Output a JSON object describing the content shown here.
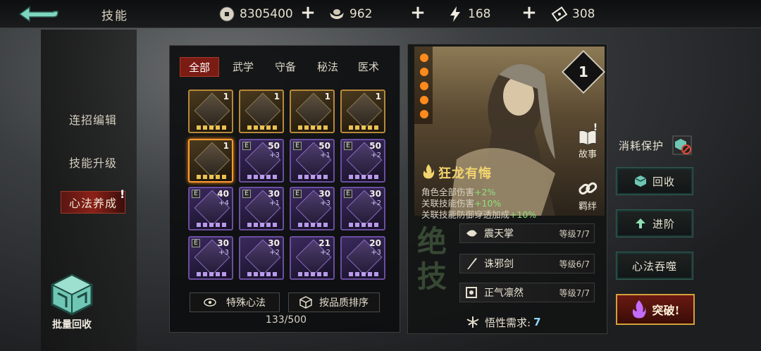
{
  "header": {
    "title": "技能",
    "resources": [
      {
        "name": "coin",
        "value": "8305400",
        "icon": "coin-icon"
      },
      {
        "name": "ingot",
        "value": "962",
        "icon": "ingot-icon"
      },
      {
        "name": "stamina",
        "value": "168",
        "icon": "lightning-icon"
      },
      {
        "name": "ticket",
        "value": "308",
        "icon": "ticket-icon"
      }
    ]
  },
  "sidebar": {
    "items": [
      {
        "label": "连招编辑"
      },
      {
        "label": "技能升级"
      },
      {
        "label": "心法养成"
      }
    ],
    "alert": "!",
    "batch_label": "批量回收"
  },
  "grid": {
    "tabs": [
      {
        "label": "全部"
      },
      {
        "label": "武学"
      },
      {
        "label": "守备"
      },
      {
        "label": "秘法"
      },
      {
        "label": "医术"
      }
    ],
    "cards": [
      {
        "lvl": "1",
        "sub": "",
        "eq": "",
        "style": "gold"
      },
      {
        "lvl": "1",
        "sub": "",
        "eq": "",
        "style": "gold"
      },
      {
        "lvl": "1",
        "sub": "",
        "eq": "",
        "style": "gold"
      },
      {
        "lvl": "1",
        "sub": "",
        "eq": "",
        "style": "gold"
      },
      {
        "lvl": "1",
        "sub": "",
        "eq": "",
        "style": "gold selected"
      },
      {
        "lvl": "50",
        "sub": "+3",
        "eq": "E",
        "style": "purple"
      },
      {
        "lvl": "50",
        "sub": "+1",
        "eq": "E",
        "style": "purple"
      },
      {
        "lvl": "50",
        "sub": "+2",
        "eq": "E",
        "style": "purple"
      },
      {
        "lvl": "40",
        "sub": "+4",
        "eq": "E",
        "style": "purple"
      },
      {
        "lvl": "30",
        "sub": "+1",
        "eq": "E",
        "style": "purple"
      },
      {
        "lvl": "30",
        "sub": "+3",
        "eq": "E",
        "style": "purple"
      },
      {
        "lvl": "30",
        "sub": "+2",
        "eq": "E",
        "style": "purple"
      },
      {
        "lvl": "30",
        "sub": "+3",
        "eq": "E",
        "style": "purple"
      },
      {
        "lvl": "30",
        "sub": "+2",
        "eq": "",
        "style": "purple"
      },
      {
        "lvl": "21",
        "sub": "+2",
        "eq": "",
        "style": "purple"
      },
      {
        "lvl": "20",
        "sub": "+3",
        "eq": "",
        "style": "purple"
      }
    ],
    "special_label": "特殊心法",
    "sort_label": "按品质排序",
    "count": "133/500"
  },
  "detail": {
    "level": "1",
    "story_label": "故事",
    "bond_label": "羁绊",
    "skill_name": "狂龙有悔",
    "stats": [
      {
        "text": "角色全部伤害",
        "bonus": "+2%"
      },
      {
        "text": "关联技能伤害",
        "bonus": "+10%"
      },
      {
        "text": "关联技能防御穿透加成",
        "bonus": "+10%"
      }
    ],
    "jueji": "绝技",
    "skills": [
      {
        "name": "震天掌",
        "grade": "等级7/7"
      },
      {
        "name": "诛邪剑",
        "grade": "等级6/7"
      },
      {
        "name": "正气凛然",
        "grade": "等级7/7"
      }
    ],
    "wuxing_label": "悟性需求:",
    "wuxing_value": "7"
  },
  "actions": {
    "protect_label": "消耗保护",
    "recycle_label": "回收",
    "advance_label": "进阶",
    "devour_label": "心法吞噬",
    "breakthrough_label": "突破!"
  },
  "colors": {
    "accent_red": "#7b1c14",
    "bonus_green": "#8fe07a",
    "gold_border": "#b8893a",
    "purple_border": "#6b4ea0",
    "teal_button": "#355a52"
  }
}
